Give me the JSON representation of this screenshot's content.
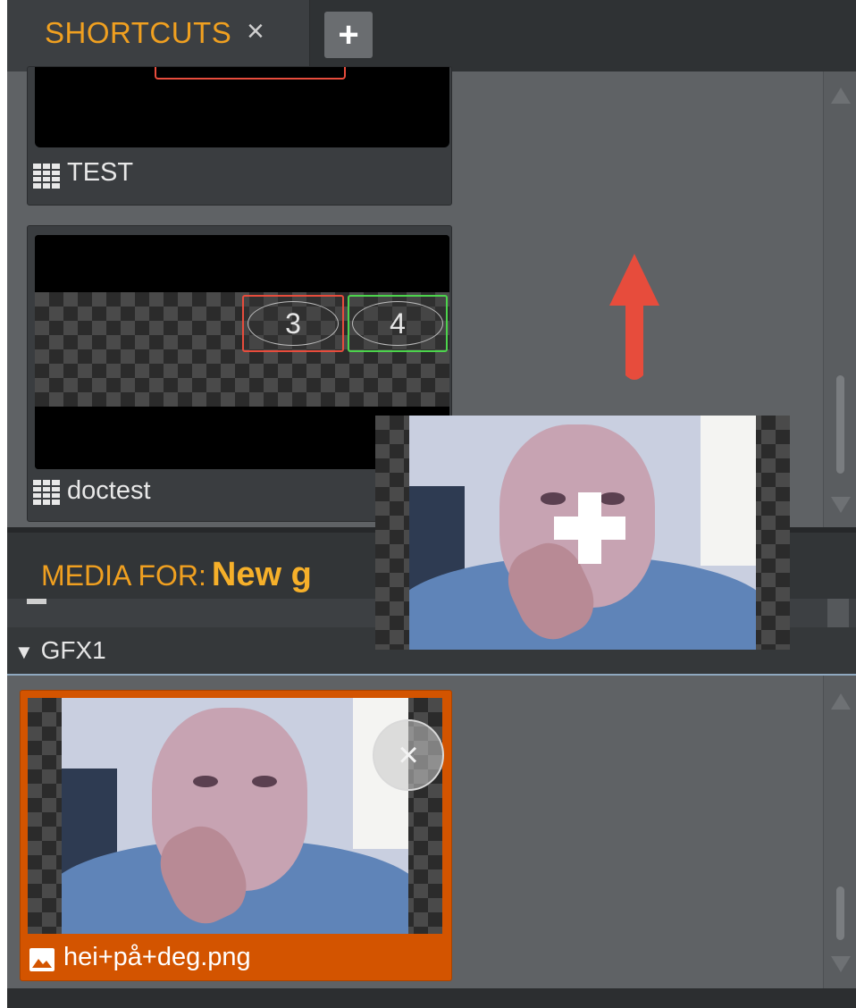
{
  "tabs": {
    "active_label": "SHORTCUTS",
    "close_glyph": "×",
    "add_glyph": "+"
  },
  "shortcuts": {
    "items": [
      {
        "label": "TEST",
        "icon": "grid-icon"
      },
      {
        "label": "doctest",
        "icon": "grid-icon",
        "slots": [
          {
            "number": "3",
            "color": "#e74c3c"
          },
          {
            "number": "4",
            "color": "#4cd44c"
          }
        ]
      }
    ]
  },
  "media": {
    "header_prefix": "MEDIA FOR:",
    "header_name": "New g"
  },
  "gfx": {
    "toggle_glyph": "▼",
    "label": "GFX1",
    "item": {
      "filename": "hei+på+deg.png",
      "icon": "image-icon",
      "remove_glyph": "×"
    }
  },
  "colors": {
    "accent": "#f0a020",
    "selected_card": "#d35400",
    "arrow": "#e74c3c"
  }
}
